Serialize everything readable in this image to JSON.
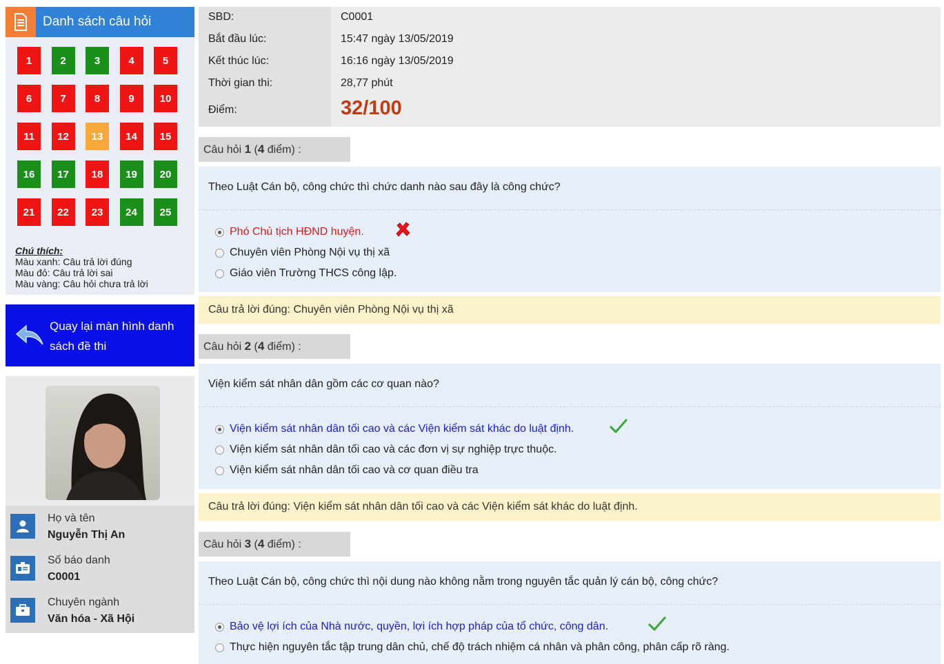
{
  "sidebar": {
    "panel_title": "Danh sách câu hỏi",
    "questions": [
      {
        "n": "1",
        "status": "wrong"
      },
      {
        "n": "2",
        "status": "right"
      },
      {
        "n": "3",
        "status": "right"
      },
      {
        "n": "4",
        "status": "wrong"
      },
      {
        "n": "5",
        "status": "wrong"
      },
      {
        "n": "6",
        "status": "wrong"
      },
      {
        "n": "7",
        "status": "wrong"
      },
      {
        "n": "8",
        "status": "wrong"
      },
      {
        "n": "9",
        "status": "wrong"
      },
      {
        "n": "10",
        "status": "wrong"
      },
      {
        "n": "11",
        "status": "wrong"
      },
      {
        "n": "12",
        "status": "wrong"
      },
      {
        "n": "13",
        "status": "unanswered"
      },
      {
        "n": "14",
        "status": "wrong"
      },
      {
        "n": "15",
        "status": "wrong"
      },
      {
        "n": "16",
        "status": "right"
      },
      {
        "n": "17",
        "status": "right"
      },
      {
        "n": "18",
        "status": "wrong"
      },
      {
        "n": "19",
        "status": "right"
      },
      {
        "n": "20",
        "status": "right"
      },
      {
        "n": "21",
        "status": "wrong"
      },
      {
        "n": "22",
        "status": "wrong"
      },
      {
        "n": "23",
        "status": "wrong"
      },
      {
        "n": "24",
        "status": "right"
      },
      {
        "n": "25",
        "status": "right"
      }
    ],
    "status_colors": {
      "right": "#1a8f1a",
      "wrong": "#f01515",
      "unanswered": "#f6a93a"
    },
    "legend": {
      "title": "Chú thích:",
      "green": "Màu xanh: Câu trả lời đúng",
      "red": "Màu đỏ: Câu trả lời sai",
      "yellow": "Màu vàng: Câu hỏi chưa trả lời"
    },
    "back_button": {
      "line1": "Quay lại màn hình danh",
      "line2": "sách đề thi"
    },
    "profile": {
      "name_label": "Họ và tên",
      "name_value": "Nguyễn Thị An",
      "id_label": "Số báo danh",
      "id_value": "C0001",
      "major_label": "Chuyên ngành",
      "major_value": "Văn hóa - Xã Hội"
    }
  },
  "summary": {
    "sbd_label": "SBD:",
    "sbd_value": "C0001",
    "start_label": "Bắt đầu lúc:",
    "start_value": "15:47 ngày 13/05/2019",
    "end_label": "Kết thúc lúc:",
    "end_value": "16:16 ngày 13/05/2019",
    "duration_label": "Thời gian thi:",
    "duration_value": "28,77 phút",
    "score_label": "Điểm:",
    "score_value": "32/100"
  },
  "questions": [
    {
      "prefix": "Câu hỏi ",
      "number": "1",
      "points_open": " (",
      "points": "4",
      "points_suffix": " điểm) :",
      "text": "Theo Luật Cán bộ, công chức thì chức danh nào sau đây là công chức?",
      "options": [
        "Phó Chủ tịch HĐND huyện.",
        "Chuyên viên Phòng Nội vụ thị xã",
        "Giáo viên Trường THCS công lập."
      ],
      "selected_result": "wrong",
      "answer": "Câu trả lời đúng: Chuyên viên Phòng Nội vụ thị xã"
    },
    {
      "prefix": "Câu hỏi ",
      "number": "2",
      "points_open": " (",
      "points": "4",
      "points_suffix": " điểm) :",
      "text": "Viện kiểm sát nhân dân gồm các cơ quan nào?",
      "options": [
        "Viện kiểm sát nhân dân tối cao và các Viện kiểm sát khác do luật định.",
        "Viện kiểm sát nhân dân tối cao và các đơn vị sự nghiệp trực thuộc.",
        "Viện kiểm sát nhân dân tối cao và cơ quan điều tra"
      ],
      "selected_result": "right",
      "answer": "Câu trả lời đúng: Viện kiểm sát nhân dân tối cao và các Viện kiểm sát khác do luật định."
    },
    {
      "prefix": "Câu hỏi ",
      "number": "3",
      "points_open": " (",
      "points": "4",
      "points_suffix": " điểm) :",
      "text": "Theo Luật Cán bộ, công chức thì nội dung nào không nằm trong nguyên tắc quản lý cán bộ, công chức?",
      "options": [
        "Bảo vệ lợi ích của Nhà nước, quyền, lợi ích hợp pháp của tổ chức, công dân.",
        "Thực hiện nguyên tắc tập trung dân chủ, chế độ trách nhiệm cá nhân và phân công, phân cấp rõ ràng."
      ],
      "selected_result": "right"
    }
  ]
}
